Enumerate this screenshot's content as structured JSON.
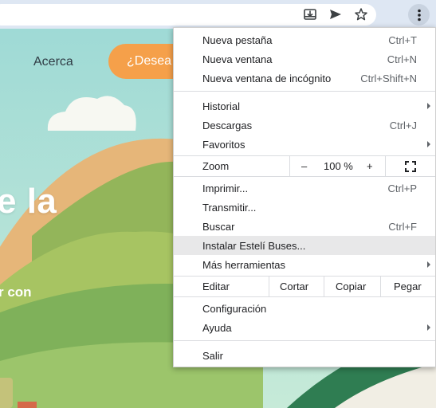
{
  "toolbar": {
    "icons": [
      "install-app-icon",
      "send-icon",
      "bookmark-star-icon",
      "menu-dots-icon"
    ]
  },
  "website": {
    "nav_link": "Acerca",
    "cta_text": "¿Desea",
    "hero_title": "e la",
    "hero_subtitle": "r con"
  },
  "menu": {
    "new_tab": "Nueva pestaña",
    "new_tab_shortcut": "Ctrl+T",
    "new_window": "Nueva ventana",
    "new_window_shortcut": "Ctrl+N",
    "incognito": "Nueva ventana de incógnito",
    "incognito_shortcut": "Ctrl+Shift+N",
    "history": "Historial",
    "downloads": "Descargas",
    "downloads_shortcut": "Ctrl+J",
    "bookmarks": "Favoritos",
    "zoom_label": "Zoom",
    "zoom_minus": "–",
    "zoom_value": "100 %",
    "zoom_plus": "+",
    "print": "Imprimir...",
    "print_shortcut": "Ctrl+P",
    "cast": "Transmitir...",
    "find": "Buscar",
    "find_shortcut": "Ctrl+F",
    "install": "Instalar Estelí Buses...",
    "more_tools": "Más herramientas",
    "edit_label": "Editar",
    "cut": "Cortar",
    "copy": "Copiar",
    "paste": "Pegar",
    "settings": "Configuración",
    "help": "Ayuda",
    "exit": "Salir"
  },
  "colors": {
    "toolbar_bg": "#dee7f3",
    "cta_orange": "#f5a04a",
    "hover_row": "#e8e8e9"
  }
}
